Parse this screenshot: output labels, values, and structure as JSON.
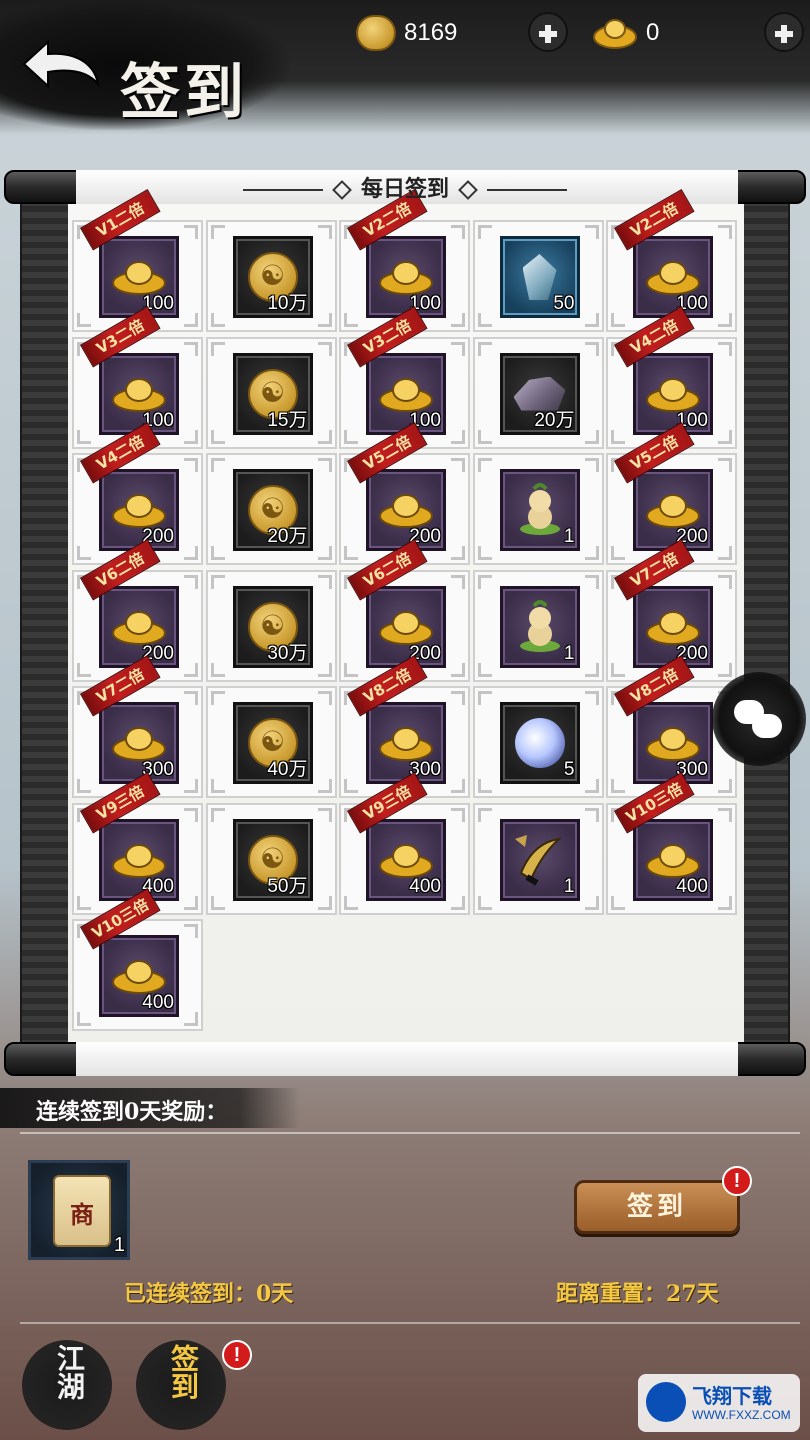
{
  "header": {
    "title": "签到",
    "coins": "8169",
    "ingots": "0"
  },
  "panel": {
    "title": "每日签到"
  },
  "grid": [
    {
      "badge": "V1二倍",
      "icon": "gold-ingot-icon",
      "qty": "100"
    },
    {
      "badge": "",
      "icon": "copper-coin-icon",
      "qty": "10万"
    },
    {
      "badge": "V2二倍",
      "icon": "gold-ingot-icon",
      "qty": "100"
    },
    {
      "badge": "",
      "icon": "crystal-icon",
      "qty": "50"
    },
    {
      "badge": "V2二倍",
      "icon": "gold-ingot-icon",
      "qty": "100"
    },
    {
      "badge": "V3二倍",
      "icon": "gold-ingot-icon",
      "qty": "100"
    },
    {
      "badge": "",
      "icon": "copper-coin-icon",
      "qty": "15万"
    },
    {
      "badge": "V3二倍",
      "icon": "gold-ingot-icon",
      "qty": "100"
    },
    {
      "badge": "",
      "icon": "ore-stone-icon",
      "qty": "20万"
    },
    {
      "badge": "V4二倍",
      "icon": "gold-ingot-icon",
      "qty": "100"
    },
    {
      "badge": "V4二倍",
      "icon": "gold-ingot-icon",
      "qty": "200"
    },
    {
      "badge": "",
      "icon": "copper-coin-icon",
      "qty": "20万"
    },
    {
      "badge": "V5二倍",
      "icon": "gold-ingot-icon",
      "qty": "200"
    },
    {
      "badge": "",
      "icon": "ginseng-baby-icon",
      "qty": "1"
    },
    {
      "badge": "V5二倍",
      "icon": "gold-ingot-icon",
      "qty": "200"
    },
    {
      "badge": "V6二倍",
      "icon": "gold-ingot-icon",
      "qty": "200"
    },
    {
      "badge": "",
      "icon": "copper-coin-icon",
      "qty": "30万"
    },
    {
      "badge": "V6二倍",
      "icon": "gold-ingot-icon",
      "qty": "200"
    },
    {
      "badge": "",
      "icon": "ginseng-baby-icon",
      "qty": "1"
    },
    {
      "badge": "V7二倍",
      "icon": "gold-ingot-icon",
      "qty": "200"
    },
    {
      "badge": "V7二倍",
      "icon": "gold-ingot-icon",
      "qty": "300"
    },
    {
      "badge": "",
      "icon": "copper-coin-icon",
      "qty": "40万"
    },
    {
      "badge": "V8二倍",
      "icon": "gold-ingot-icon",
      "qty": "300"
    },
    {
      "badge": "",
      "icon": "spirit-orb-icon",
      "qty": "5"
    },
    {
      "badge": "V8二倍",
      "icon": "gold-ingot-icon",
      "qty": "300"
    },
    {
      "badge": "V9三倍",
      "icon": "gold-ingot-icon",
      "qty": "400"
    },
    {
      "badge": "",
      "icon": "copper-coin-icon",
      "qty": "50万"
    },
    {
      "badge": "V9三倍",
      "icon": "gold-ingot-icon",
      "qty": "400"
    },
    {
      "badge": "",
      "icon": "weapon-fragment-icon",
      "qty": "1"
    },
    {
      "badge": "V10三倍",
      "icon": "gold-ingot-icon",
      "qty": "400"
    },
    {
      "badge": "V10三倍",
      "icon": "gold-ingot-icon",
      "qty": "400"
    }
  ],
  "streak": {
    "banner": "连续签到0天奖励：",
    "reward_icon_text": "商",
    "reward_qty": "1",
    "sign_label": "签到",
    "badge": "!",
    "streak_text": "已连续签到：0天",
    "reset_text": "距离重置：27天"
  },
  "nav": {
    "item1": "江湖",
    "item2": "签到",
    "badge": "!"
  },
  "watermark": {
    "title": "飞翔下载",
    "url": "WWW.FXXZ.COM"
  }
}
